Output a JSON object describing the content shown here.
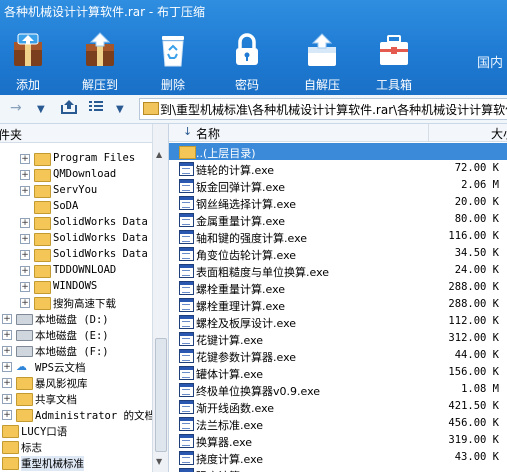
{
  "window": {
    "title": "各种机械设计计算软件.rar - 布丁压缩"
  },
  "toolbar": {
    "buttons": [
      {
        "label": "添加",
        "icon": "add-archive-icon"
      },
      {
        "label": "解压到",
        "icon": "extract-to-icon"
      },
      {
        "label": "删除",
        "icon": "recycle-delete-icon"
      },
      {
        "label": "密码",
        "icon": "lock-icon"
      },
      {
        "label": "自解压",
        "icon": "self-extract-icon"
      },
      {
        "label": "工具箱",
        "icon": "toolbox-icon"
      }
    ],
    "brand_text": "国内"
  },
  "nav": {
    "back_icon": "back-arrow-icon",
    "forward_icon": "forward-arrow-icon",
    "up_icon": "up-folder-icon",
    "view_icon": "list-view-icon",
    "address": "到\\重型机械标准\\各种机械设计计算软件.rar\\各种机械设计计算软件"
  },
  "tree": {
    "header": "件夹",
    "items": [
      {
        "label": "Program Files",
        "kind": "folder",
        "expander": "+"
      },
      {
        "label": "QMDownload",
        "kind": "folder",
        "expander": "+"
      },
      {
        "label": "ServYou",
        "kind": "folder",
        "expander": "+"
      },
      {
        "label": "SoDA",
        "kind": "folder",
        "expander": ""
      },
      {
        "label": "SolidWorks Data",
        "kind": "folder",
        "expander": "+"
      },
      {
        "label": "SolidWorks Data",
        "kind": "folder",
        "expander": "+"
      },
      {
        "label": "SolidWorks Data",
        "kind": "folder",
        "expander": "+"
      },
      {
        "label": "TDDOWNLOAD",
        "kind": "folder",
        "expander": "+"
      },
      {
        "label": "WINDOWS",
        "kind": "folder",
        "expander": "+"
      },
      {
        "label": "搜狗高速下载",
        "kind": "folder",
        "expander": "+"
      },
      {
        "label": "本地磁盘 (D:)",
        "kind": "drive",
        "expander": "+"
      },
      {
        "label": "本地磁盘 (E:)",
        "kind": "drive",
        "expander": "+"
      },
      {
        "label": "本地磁盘 (F:)",
        "kind": "drive",
        "expander": "+"
      },
      {
        "label": "WPS云文档",
        "kind": "cloud",
        "expander": "+"
      },
      {
        "label": "暴风影视库",
        "kind": "folder",
        "expander": "+"
      },
      {
        "label": "共享文档",
        "kind": "folder",
        "expander": "+"
      },
      {
        "label": "Administrator 的文档",
        "kind": "folder",
        "expander": "+"
      },
      {
        "label": "LUCY口语",
        "kind": "folder",
        "expander": ""
      },
      {
        "label": "标志",
        "kind": "folder",
        "expander": ""
      },
      {
        "label": "重型机械标准",
        "kind": "folder",
        "expander": "",
        "selected": true
      }
    ]
  },
  "list": {
    "columns": {
      "name": "名称",
      "size": "大小"
    },
    "parent_row": "..(上层目录)",
    "files": [
      {
        "name": "链轮的计算.exe",
        "size": "72.00 K"
      },
      {
        "name": "钣金回弹计算.exe",
        "size": "2.06 M"
      },
      {
        "name": "钢丝绳选择计算.exe",
        "size": "20.00 K"
      },
      {
        "name": "金属重量计算.exe",
        "size": "80.00 K"
      },
      {
        "name": "轴和键的强度计算.exe",
        "size": "116.00 K"
      },
      {
        "name": "角变位齿轮计算.exe",
        "size": "34.50 K"
      },
      {
        "name": "表面粗糙度与单位换算.exe",
        "size": "24.00 K"
      },
      {
        "name": "螺栓重量计算.exe",
        "size": "288.00 K"
      },
      {
        "name": "螺栓重理计算.exe",
        "size": "288.00 K"
      },
      {
        "name": "螺栓及板厚设计.exe",
        "size": "112.00 K"
      },
      {
        "name": "花键计算.exe",
        "size": "312.00 K"
      },
      {
        "name": "花键参数计算器.exe",
        "size": "44.00 K"
      },
      {
        "name": "罐体计算.exe",
        "size": "156.00 K"
      },
      {
        "name": "终极单位换算器v0.9.exe",
        "size": "1.08 M"
      },
      {
        "name": "渐开线函数.exe",
        "size": "421.50 K"
      },
      {
        "name": "法兰标准.exe",
        "size": "456.00 K"
      },
      {
        "name": "换算器.exe",
        "size": "319.00 K"
      },
      {
        "name": "挠度计算.exe",
        "size": "43.00 K"
      },
      {
        "name": "强度计算.exe",
        "size": ""
      }
    ]
  }
}
